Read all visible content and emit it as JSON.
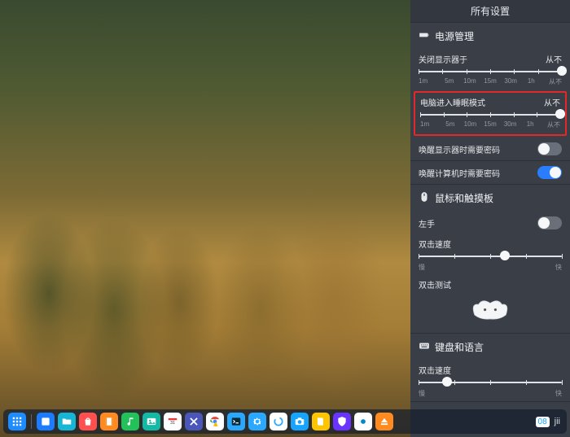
{
  "panel": {
    "title": "所有设置",
    "power": {
      "header": "电源管理",
      "display_off": {
        "label": "关闭显示器于",
        "value": "从不",
        "ticks": [
          "1m",
          "5m",
          "10m",
          "15m",
          "30m",
          "1h",
          "从不"
        ]
      },
      "sleep": {
        "label": "电脑进入睡眠模式",
        "value": "从不",
        "ticks": [
          "1m",
          "5m",
          "10m",
          "15m",
          "30m",
          "1h",
          "从不"
        ]
      },
      "wake_display_pw": {
        "label": "唤醒显示器时需要密码",
        "on": false
      },
      "wake_computer_pw": {
        "label": "唤醒计算机时需要密码",
        "on": true
      }
    },
    "mouse": {
      "header": "鼠标和触摸板",
      "left_hand": {
        "label": "左手",
        "on": false
      },
      "dbl_speed": {
        "label": "双击速度",
        "min": "慢",
        "max": "快"
      },
      "dbl_test": {
        "label": "双击测试"
      }
    },
    "keyboard": {
      "header": "键盘和语言",
      "repeat_speed": {
        "label": "双击速度",
        "min": "慢",
        "max": "快"
      }
    }
  },
  "dock": {
    "items": [
      {
        "name": "launcher",
        "bg": "#1c8cff",
        "glyph": "grid"
      },
      {
        "name": "multitask",
        "bg": "#1c7cff",
        "glyph": "square"
      },
      {
        "name": "file-manager",
        "bg": "#17b6d6",
        "glyph": "folder"
      },
      {
        "name": "store",
        "bg": "#ff4f4f",
        "glyph": "bag"
      },
      {
        "name": "video",
        "bg": "#ff8a1f",
        "glyph": "film"
      },
      {
        "name": "music",
        "bg": "#22c15a",
        "glyph": "note"
      },
      {
        "name": "viewer",
        "bg": "#13b9a4",
        "glyph": "image"
      },
      {
        "name": "calendar",
        "bg": "#ffffff",
        "glyph": "cal"
      },
      {
        "name": "crossover",
        "bg": "#4a56b8",
        "glyph": "x"
      },
      {
        "name": "chrome",
        "bg": "#ffffff",
        "glyph": "chrome"
      },
      {
        "name": "terminal",
        "bg": "#2aa8ff",
        "glyph": "term"
      },
      {
        "name": "settings",
        "bg": "#2aa8ff",
        "glyph": "gear"
      },
      {
        "name": "spinner",
        "bg": "#ffffff",
        "glyph": "ring"
      },
      {
        "name": "camera",
        "bg": "#17a4ff",
        "glyph": "cam"
      },
      {
        "name": "manual",
        "bg": "#ffc400",
        "glyph": "book"
      },
      {
        "name": "safe",
        "bg": "#6a34ff",
        "glyph": "shield"
      },
      {
        "name": "deepin",
        "bg": "#ffffff",
        "glyph": "logo"
      },
      {
        "name": "eject",
        "bg": "#ff8a1f",
        "glyph": "eject"
      }
    ],
    "tray": {
      "badge": "08",
      "time": "jii"
    }
  }
}
